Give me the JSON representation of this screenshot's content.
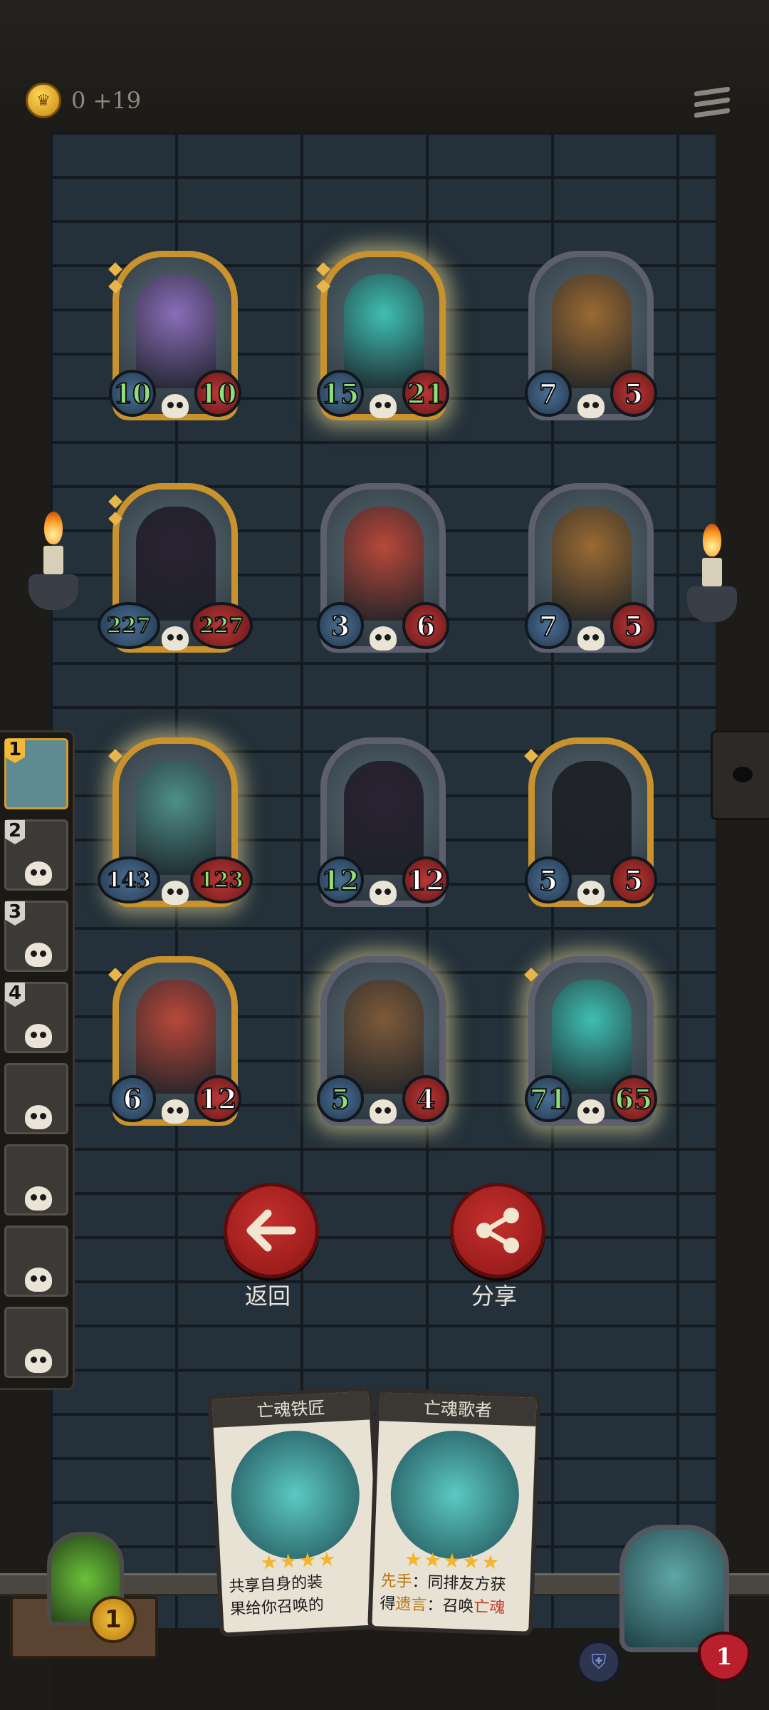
{
  "top_bar": {
    "gold_text": "0 +19",
    "gold_icon": "crown-coin-icon",
    "menu_icon": "menu-icon"
  },
  "board": {
    "rows": [
      [
        {
          "atk": "10",
          "hp": "10",
          "frame": "gold",
          "glow": false,
          "tier_marks": 2,
          "portrait": "sorceress",
          "color": "#8a6db8"
        },
        {
          "atk": "15",
          "hp": "21",
          "frame": "gold",
          "glow": true,
          "tier_marks": 2,
          "portrait": "ghost-blacksmith",
          "color": "#3fbfb3"
        },
        {
          "atk": "7",
          "hp": "5",
          "frame": "silver",
          "glow": false,
          "tier_marks": 0,
          "portrait": "pumpkin-lock",
          "color": "#9a6a33"
        }
      ],
      [
        {
          "atk": "227",
          "hp": "227",
          "frame": "gold",
          "glow": false,
          "tier_marks": 2,
          "portrait": "dark-knight",
          "color": "#2b2233"
        },
        {
          "atk": "3",
          "hp": "6",
          "frame": "silver",
          "glow": false,
          "tier_marks": 0,
          "portrait": "red-hair-singer",
          "color": "#b8483a"
        },
        {
          "atk": "7",
          "hp": "5",
          "frame": "silver",
          "glow": false,
          "tier_marks": 0,
          "portrait": "pumpkin-lock",
          "color": "#9a6a33"
        }
      ],
      [
        {
          "atk": "143",
          "hp": "123",
          "frame": "gold",
          "glow": true,
          "tier_marks": 1,
          "portrait": "spirit-banshee",
          "color": "#4f8f8a"
        },
        {
          "atk": "12",
          "hp": "12",
          "frame": "silver",
          "glow": false,
          "tier_marks": 0,
          "portrait": "dark-knight",
          "color": "#2b2233"
        },
        {
          "atk": "5",
          "hp": "5",
          "frame": "gold",
          "glow": false,
          "tier_marks": 1,
          "portrait": "hooded-reaper",
          "color": "#22242a"
        }
      ],
      [
        {
          "atk": "6",
          "hp": "12",
          "frame": "gold",
          "glow": false,
          "tier_marks": 1,
          "portrait": "red-hair-singer",
          "color": "#b8483a"
        },
        {
          "atk": "5",
          "hp": "4",
          "frame": "silver",
          "glow": true,
          "tier_marks": 0,
          "portrait": "cannon-bomb",
          "color": "#7d5a3a"
        },
        {
          "atk": "71",
          "hp": "65",
          "frame": "silver",
          "glow": true,
          "tier_marks": 1,
          "portrait": "ghost-blacksmith",
          "color": "#3fbfb3"
        }
      ]
    ]
  },
  "sidebar": {
    "slots": [
      {
        "number": "1",
        "active": true
      },
      {
        "number": "2",
        "active": false
      },
      {
        "number": "3",
        "active": false
      },
      {
        "number": "4",
        "active": false
      },
      {
        "number": "",
        "active": false
      },
      {
        "number": "",
        "active": false
      },
      {
        "number": "",
        "active": false
      },
      {
        "number": "",
        "active": false
      }
    ]
  },
  "actions": {
    "back_label": "返回",
    "share_label": "分享",
    "back_icon": "arrow-left-icon",
    "share_icon": "share-icon"
  },
  "hand": {
    "cards": [
      {
        "title": "亡魂铁匠",
        "stars": "★★★★",
        "line1": "共享自身的装",
        "line2": "果给你召唤的"
      },
      {
        "title": "亡魂歌者",
        "stars": "★★★★★",
        "line1_kw": "先手",
        "line1": "：同排友方获",
        "line2_a": "得",
        "line2_kw": "遗言",
        "line2_b": "：召唤",
        "line2_kw2": "亡魂"
      }
    ]
  },
  "player": {
    "deck_count": "1",
    "health": "1",
    "shield_icon": "shield-icon"
  },
  "colors": {
    "gold_frame": "#c9922c",
    "silver_frame": "#5d5f6e",
    "attack_blue": "#4a6f93",
    "health_red": "#b83838",
    "button_red": "#c4302d"
  }
}
